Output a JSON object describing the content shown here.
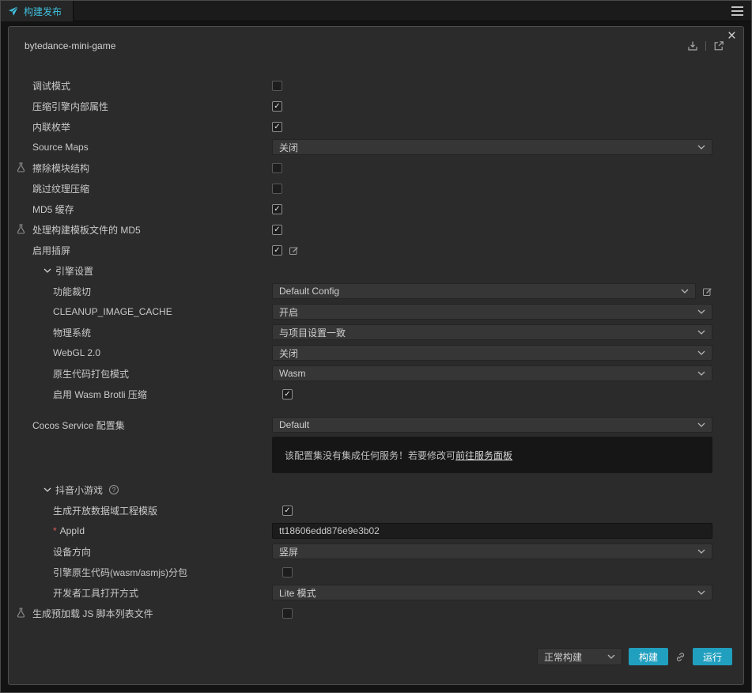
{
  "topbar": {
    "tab_label": "构建发布"
  },
  "dialog": {
    "title": "bytedance-mini-game"
  },
  "form": {
    "debug_mode": {
      "label": "调试模式",
      "checked": false
    },
    "compress_engine_props": {
      "label": "压缩引擎内部属性",
      "checked": true
    },
    "inline_enum": {
      "label": "内联枚举",
      "checked": true
    },
    "source_maps": {
      "label": "Source Maps",
      "value": "关闭"
    },
    "erase_module_structure": {
      "label": "擦除模块结构",
      "checked": false
    },
    "skip_texture_compression": {
      "label": "跳过纹理压缩",
      "checked": false
    },
    "md5_cache": {
      "label": "MD5 缓存",
      "checked": true
    },
    "md5_build_template": {
      "label": "处理构建模板文件的 MD5",
      "checked": true
    },
    "splash_screen": {
      "label": "启用插屏",
      "checked": true
    },
    "engine_settings": {
      "label": "引擎设置"
    },
    "feature_cropping": {
      "label": "功能裁切",
      "value": "Default Config"
    },
    "cleanup_image_cache": {
      "label": "CLEANUP_IMAGE_CACHE",
      "value": "开启"
    },
    "physics_system": {
      "label": "物理系统",
      "value": "与项目设置一致"
    },
    "webgl2": {
      "label": "WebGL 2.0",
      "value": "关闭"
    },
    "native_code_bundle_mode": {
      "label": "原生代码打包模式",
      "value": "Wasm"
    },
    "wasm_brotli": {
      "label": "启用 Wasm Brotli 压缩",
      "checked": true
    },
    "cocos_service": {
      "label": "Cocos Service 配置集",
      "value": "Default"
    },
    "service_notice": {
      "text": "该配置集没有集成任何服务！若要修改可",
      "link": "前往服务面板"
    },
    "douyin_section": {
      "label": "抖音小游戏"
    },
    "open_data_template": {
      "label": "生成开放数据域工程模版",
      "checked": true
    },
    "app_id": {
      "required_mark": "*",
      "label": "AppId",
      "value": "tt18606edd876e9e3b02"
    },
    "device_orientation": {
      "label": "设备方向",
      "value": "竖屏"
    },
    "native_code_subpackage": {
      "label": "引擎原生代码(wasm/asmjs)分包",
      "checked": false
    },
    "devtools_open_mode": {
      "label": "开发者工具打开方式",
      "value": "Lite 模式"
    },
    "preload_js_list": {
      "label": "生成预加载 JS 脚本列表文件",
      "checked": false
    }
  },
  "footer": {
    "build_mode": "正常构建",
    "build_label": "构建",
    "run_label": "运行"
  },
  "icons": {
    "close": "×",
    "check": "✓",
    "help": "?"
  },
  "colors": {
    "accent": "#3fc0de",
    "primary_button": "#219fbe",
    "required": "#e05a5a"
  }
}
